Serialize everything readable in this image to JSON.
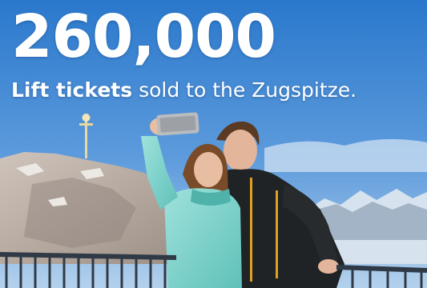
{
  "headline": {
    "number": "260,000"
  },
  "caption": {
    "emphasis": "Lift tickets",
    "rest": " sold to the Zugspitze."
  },
  "colors": {
    "sky_top": "#2f7fd0",
    "sky_bottom": "#a9cbe8",
    "text": "#ffffff",
    "jacket_mint": "#7fd3cc",
    "jacket_dark": "#1f2326",
    "zip_accent": "#e0a020",
    "rock": "#b7aaa1"
  }
}
